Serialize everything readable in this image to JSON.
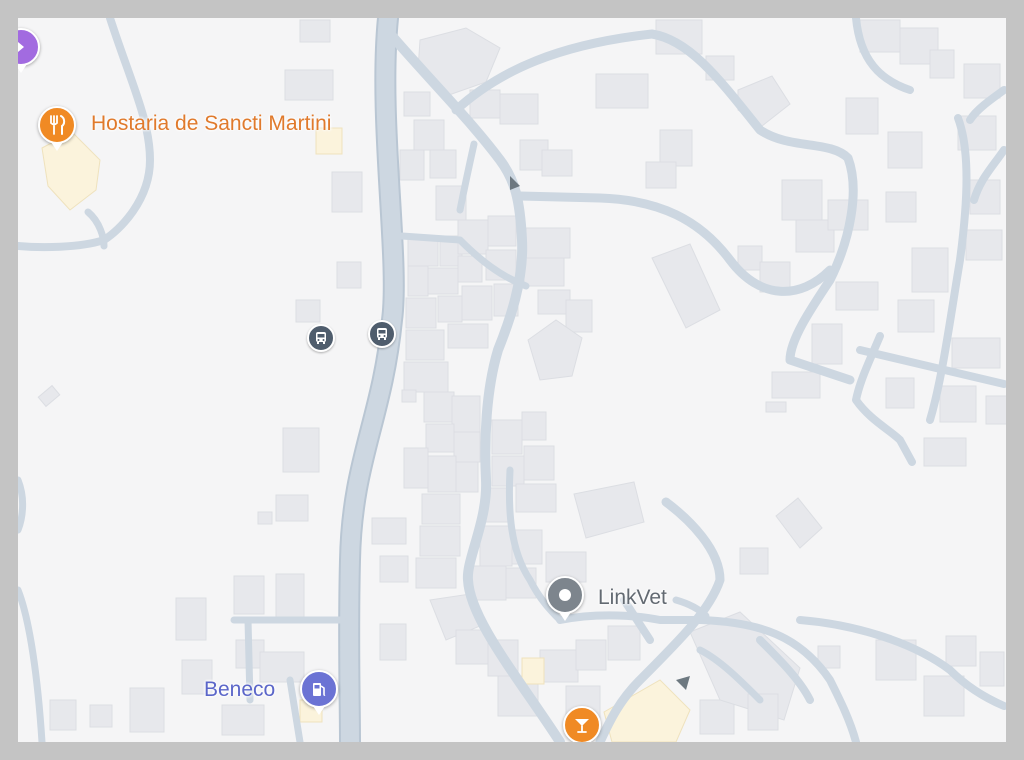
{
  "map": {
    "pois": {
      "restaurant": {
        "label": "Hostaria de Sancti Martini",
        "icon": "fork-knife-icon",
        "color": "#f08a24"
      },
      "vet": {
        "label": "LinkVet",
        "icon": "location-dot-icon",
        "color": "#7d858d"
      },
      "gas_station": {
        "label": "Beneco",
        "icon": "fuel-pump-icon",
        "color": "#6b73d4"
      },
      "bar": {
        "icon": "cocktail-glass-icon",
        "color": "#f08a24"
      },
      "offscreen_place": {
        "icon": "purple-place-pin-icon",
        "color": "#a26be0"
      }
    },
    "transit": [
      {
        "icon": "bus-icon"
      },
      {
        "icon": "bus-icon"
      }
    ],
    "one_way_arrows": 2
  }
}
